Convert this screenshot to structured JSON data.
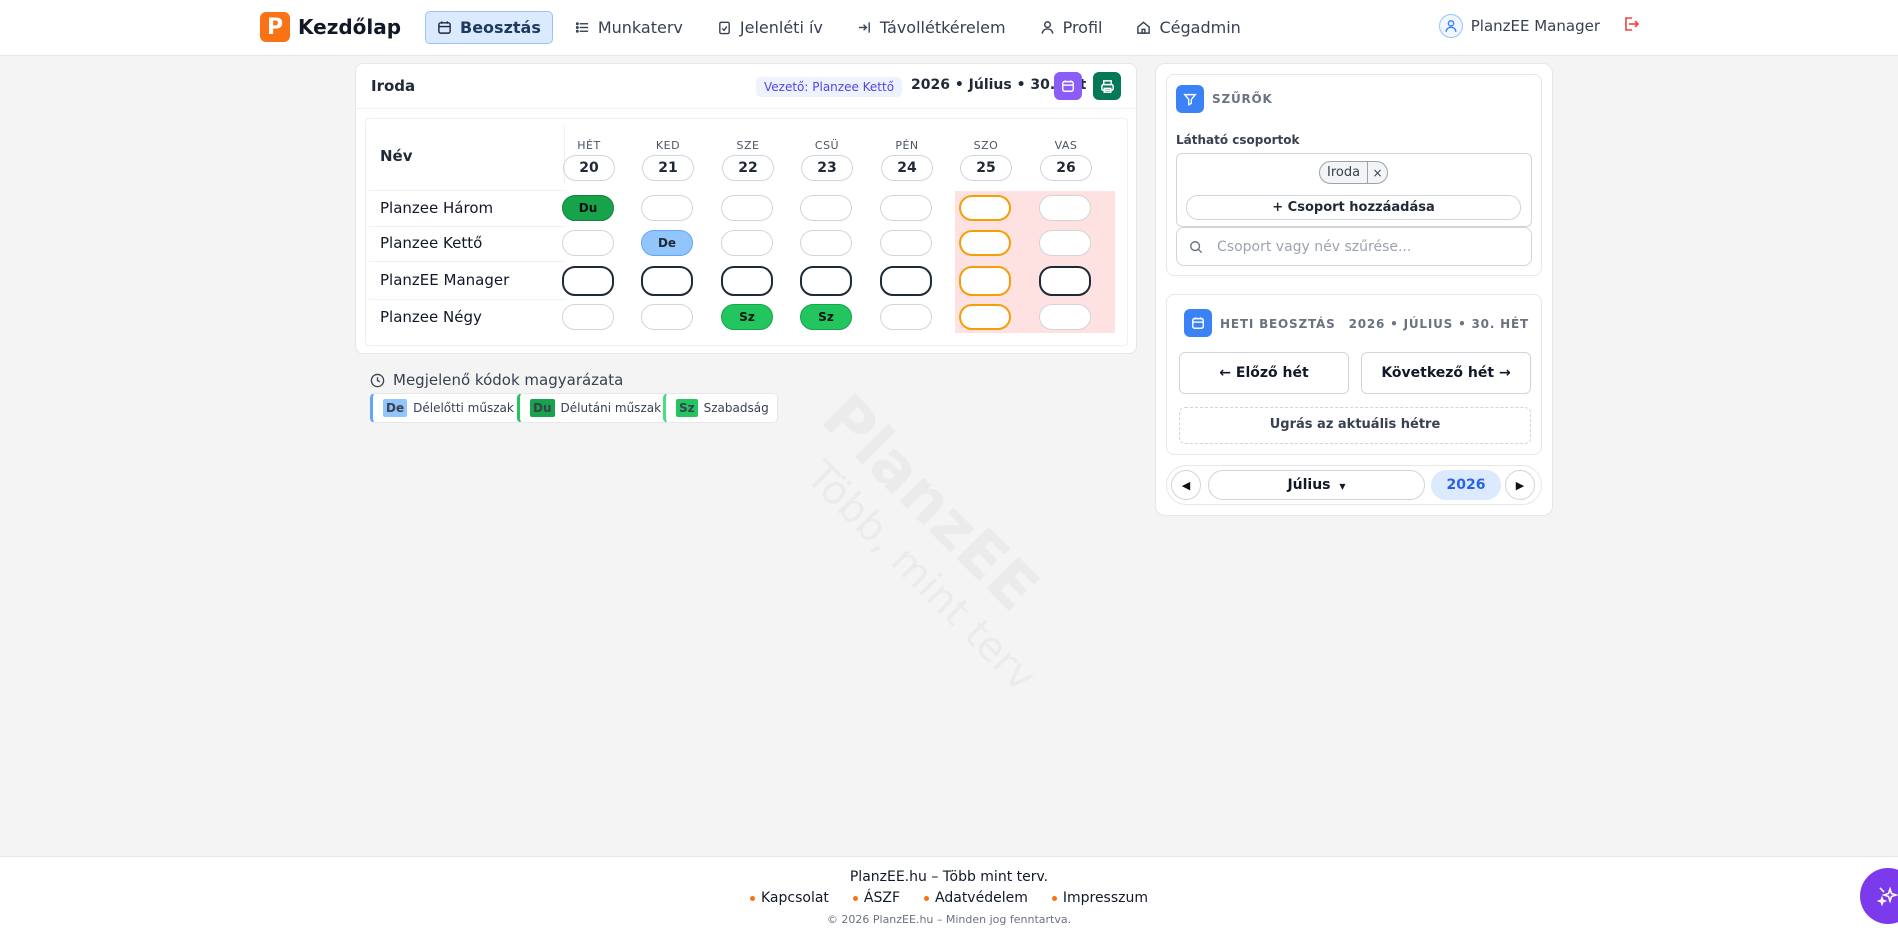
{
  "nav": {
    "brand": "Kezdőlap",
    "brand_logo": "P",
    "items": [
      {
        "label": "Beosztás",
        "icon": "calendar-icon",
        "active": true
      },
      {
        "label": "Munkaterv",
        "icon": "list-icon"
      },
      {
        "label": "Jelenléti ív",
        "icon": "clipboard-check-icon"
      },
      {
        "label": "Távollétkérelem",
        "icon": "login-arrow-icon"
      },
      {
        "label": "Profil",
        "icon": "user-icon"
      },
      {
        "label": "Cégadmin",
        "icon": "home-icon"
      }
    ],
    "user_name": "PlanzEE Manager",
    "logout_icon": "logout-icon"
  },
  "schedule": {
    "title": "Iroda",
    "leader": "Vezető: Planzee Kettő",
    "week": "2026 • Július • 30. hét",
    "name_header": "Név",
    "days": [
      {
        "name": "HÉT",
        "num": "20"
      },
      {
        "name": "KED",
        "num": "21"
      },
      {
        "name": "SZE",
        "num": "22"
      },
      {
        "name": "CSÜ",
        "num": "23"
      },
      {
        "name": "PÉN",
        "num": "24"
      },
      {
        "name": "SZO",
        "num": "25"
      },
      {
        "name": "VAS",
        "num": "26"
      }
    ],
    "rows": [
      {
        "name": "Planzee Három",
        "cells": [
          "Du",
          "",
          "",
          "",
          "",
          "",
          ""
        ]
      },
      {
        "name": "Planzee Kettő",
        "cells": [
          "",
          "De",
          "",
          "",
          "",
          "",
          ""
        ]
      },
      {
        "name": "PlanzEE Manager",
        "cells": [
          "",
          "",
          "",
          "",
          "",
          "",
          ""
        ]
      },
      {
        "name": "Planzee Négy",
        "cells": [
          "",
          "",
          "Sz",
          "Sz",
          "",
          "",
          ""
        ]
      }
    ]
  },
  "legend": {
    "title": "Megjelenő kódok magyarázata",
    "items": [
      {
        "code": "De",
        "label": "Délelőtti műszak",
        "color": "#93c5fd",
        "bar": "#60a5fa"
      },
      {
        "code": "Du",
        "label": "Délutáni műszak",
        "color": "#16a34a",
        "bar": "#22c55e"
      },
      {
        "code": "Sz",
        "label": "Szabadság",
        "color": "#22c55e",
        "bar": "#4ade80"
      }
    ]
  },
  "filters": {
    "title": "SZŰRŐK",
    "groups_label": "Látható csoportok",
    "group_tag": "Iroda",
    "remove_symbol": "×",
    "add_group": "+ Csoport hozzáadása",
    "search_placeholder": "Csoport vagy név szűrése..."
  },
  "weekly": {
    "title": "HETI BEOSZTÁS",
    "info": "2026 • JÚLIUS • 30. HÉT",
    "prev": "← Előző hét",
    "next": "Következő hét →",
    "today": "Ugrás az aktuális hétre"
  },
  "monthnav": {
    "prev_arrow": "◀",
    "next_arrow": "▶",
    "month": "Július",
    "year": "2026"
  },
  "watermark": {
    "big": "PlanzEE",
    "small": "Több, mint terv"
  },
  "footer": {
    "tagline": "PlanzEE.hu – Több mint terv.",
    "links": [
      "Kapcsolat",
      "ÁSZF",
      "Adatvédelem",
      "Impresszum"
    ],
    "copyright": "© 2026 PlanzEE.hu – Minden jog fenntartva."
  },
  "colors": {
    "accent": "#f97316",
    "primary": "#2563eb",
    "weekend": "#fee2e2",
    "fab": "#7c3aed"
  }
}
